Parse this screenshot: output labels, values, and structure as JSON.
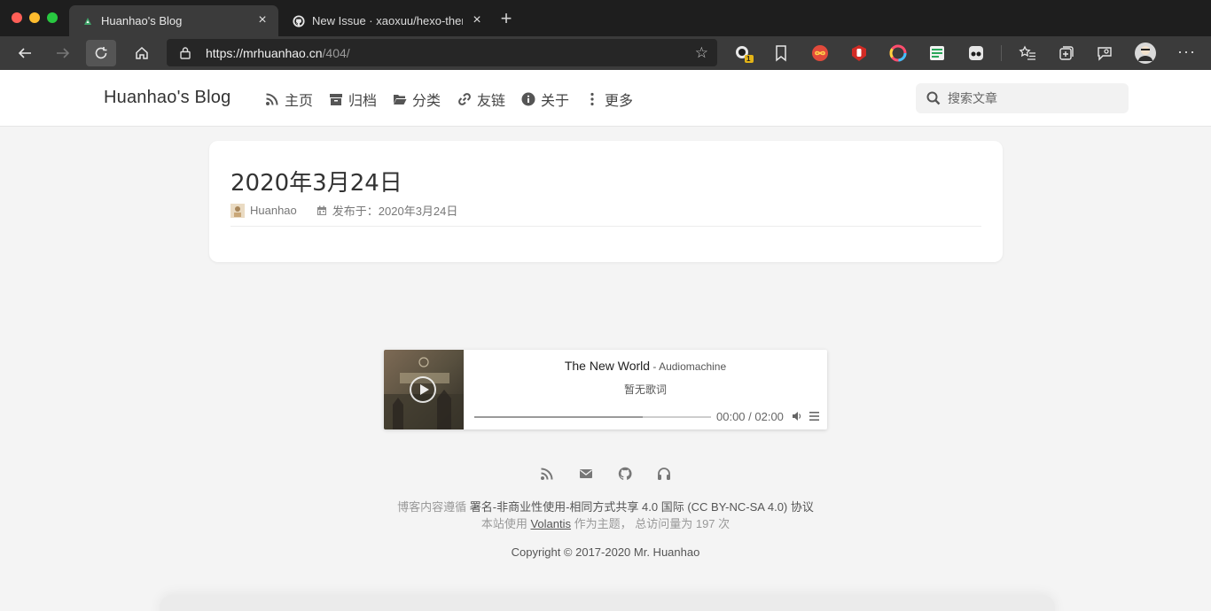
{
  "browser": {
    "tabs": [
      {
        "title": "Huanhao's Blog",
        "active": true
      },
      {
        "title": "New Issue · xaoxuu/hexo-theme-volantis",
        "active": false
      }
    ],
    "new_tab_label": "+",
    "tab_close_label": "×",
    "url_host": "https://mrhuanhao.cn",
    "url_path": "/404/",
    "extension_badge": "1",
    "more_label": "···"
  },
  "site": {
    "brand": "Huanhao's Blog",
    "nav": [
      {
        "label": "主页",
        "icon": "rss-icon"
      },
      {
        "label": "归档",
        "icon": "archive-icon"
      },
      {
        "label": "分类",
        "icon": "folder-open-icon"
      },
      {
        "label": "友链",
        "icon": "link-icon"
      },
      {
        "label": "关于",
        "icon": "info-circle-icon"
      },
      {
        "label": "更多",
        "icon": "ellipsis-vertical-icon"
      }
    ],
    "search_placeholder": "搜索文章"
  },
  "post": {
    "title": "2020年3月24日",
    "author": "Huanhao",
    "date_label": "发布于：2020年3月24日"
  },
  "player": {
    "song": "The New World",
    "separator": " - ",
    "artist": "Audiomachine",
    "lyric": "暂无歌词",
    "time": "00:00 / 02:00",
    "progress_fraction": 0.71
  },
  "footer": {
    "license_prefix": "博客内容遵循 ",
    "license": "署名-非商业性使用-相同方式共享 4.0 国际 (CC BY-NC-SA 4.0) 协议",
    "theme_prefix": "本站使用 ",
    "theme_link": "Volantis",
    "theme_suffix": " 作为主题， 总访问量为 197 次",
    "copyright": "Copyright © 2017-2020 Mr. Huanhao",
    "social": [
      "rss-icon",
      "envelope-icon",
      "github-icon",
      "headphones-icon"
    ]
  },
  "colors": {
    "page_bg": "#f4f4f4",
    "chrome_dark": "#1e1e1e",
    "toolbar": "#3b3b3b",
    "text_main": "#333333"
  }
}
